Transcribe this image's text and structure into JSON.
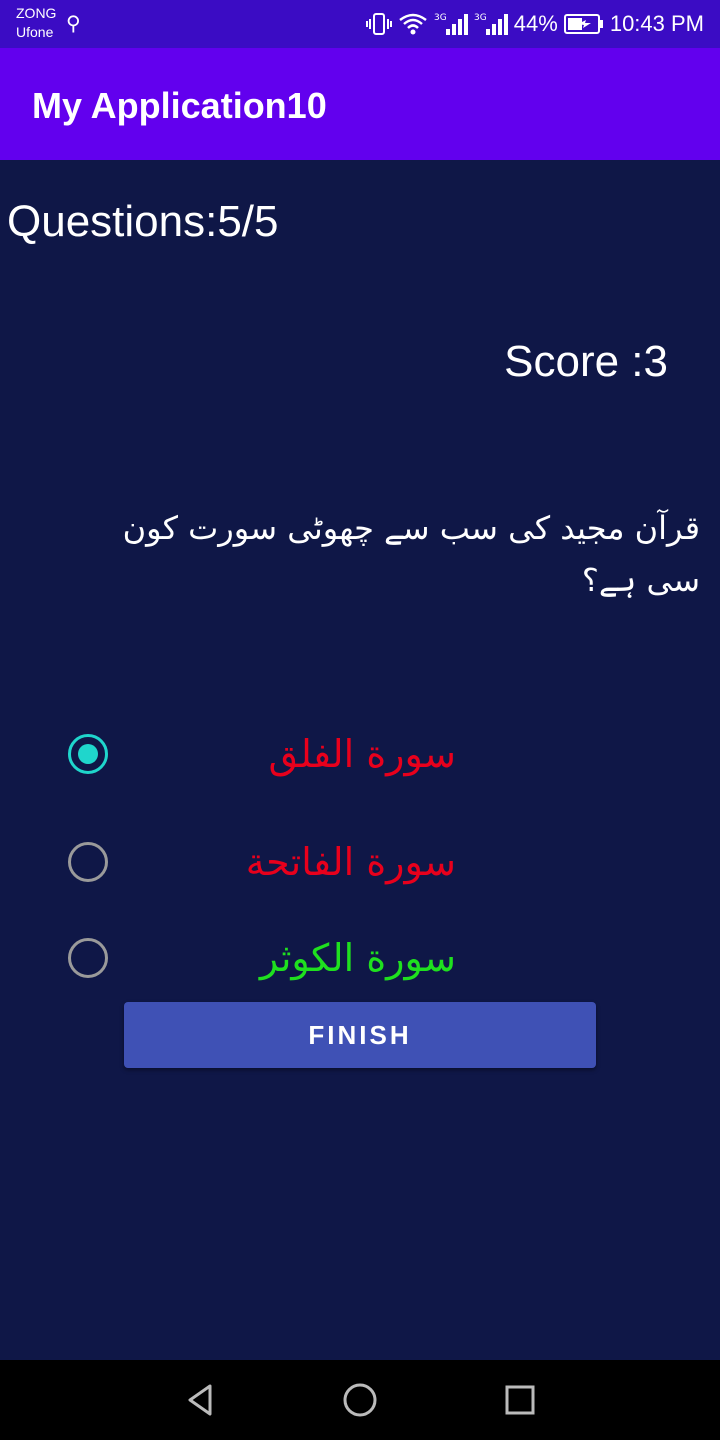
{
  "status_bar": {
    "carrier_1": "ZONG",
    "carrier_2": "Ufone",
    "battery": "44%",
    "time": "10:43 PM",
    "net_1": "3G",
    "net_2": "3G",
    "icons": [
      "usb-icon",
      "vibrate-icon",
      "wifi-icon",
      "signal-icon",
      "battery-icon"
    ]
  },
  "app_bar": {
    "title": "My Application10"
  },
  "quiz": {
    "questions_label": "Questions:5/5",
    "score_label": "Score :3",
    "question": "قرآن مجید کی سب سے چھوٹی سورت کون سی ہے؟",
    "options": [
      {
        "label": "سورة الفلق",
        "selected": true,
        "color": "#e8001c"
      },
      {
        "label": "سورة الفاتحة",
        "selected": false,
        "color": "#e8001c"
      },
      {
        "label": "سورة الكوثر",
        "selected": false,
        "color": "#1fe01f"
      }
    ],
    "finish_label": "FINISH"
  },
  "colors": {
    "status_bar": "#3b0cc4",
    "app_bar": "#6200ee",
    "background": "#0f1747",
    "button": "#3f51b5",
    "radio_accent": "#1fd6cc"
  },
  "nav_bar": {
    "icons": [
      "back-icon",
      "home-icon",
      "recents-icon"
    ]
  }
}
